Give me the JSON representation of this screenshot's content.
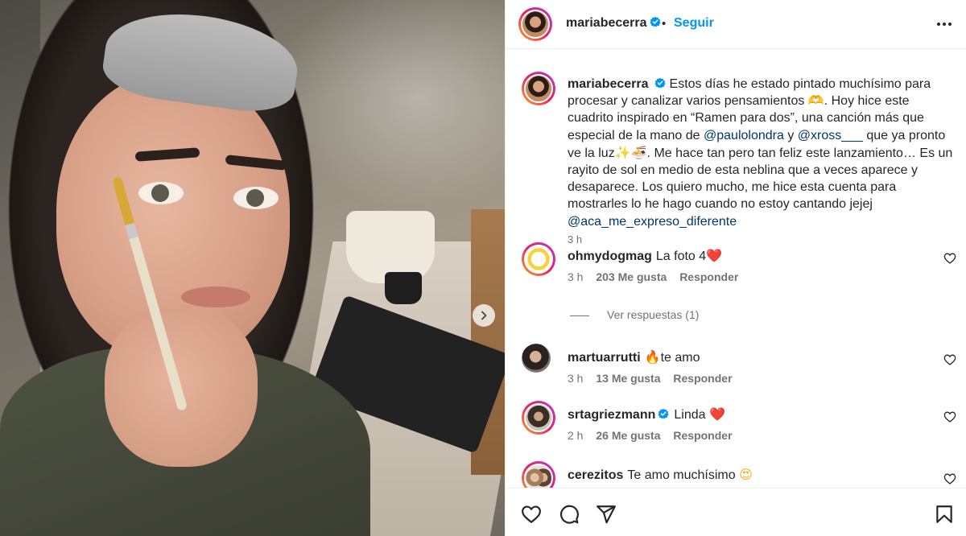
{
  "post": {
    "username": "mariabecerra",
    "follow_label": "Seguir",
    "separator": "•"
  },
  "caption": {
    "username": "mariabecerra",
    "text_1": "Estos días he estado pintado muchísimo para procesar y canalizar varios pensamientos 🫶. Hoy hice este cuadrito inspirado en “Ramen para dos”, una canción más que especial de la mano de ",
    "mention_1": "@paulolondra",
    "text_2": " y ",
    "mention_2": "@xross___",
    "text_3": " que ya pronto ve la luz",
    "emoji_1": "✨🍜",
    "text_4": ". Me hace tan pero tan feliz este lanzamiento… Es un rayito de sol en medio de esta neblina que a veces aparece y desaparece. Los quiero mucho, me hice esta cuenta para mostrarles lo he hago cuando no estoy cantando jejej ",
    "mention_3": "@aca_me_expreso_diferente",
    "time": "3 h"
  },
  "comments": [
    {
      "username": "ohmydogmag",
      "text": "La foto 4",
      "emoji": "❤️",
      "time": "3 h",
      "likes": "203 Me gusta",
      "reply": "Responder",
      "avatar": "face-b",
      "verified": false,
      "ring": true
    },
    {
      "username": "martuarrutti",
      "text": "te amo",
      "emoji_pre": "🔥",
      "time": "3 h",
      "likes": "13 Me gusta",
      "reply": "Responder",
      "avatar": "face-c",
      "verified": false,
      "ring": false
    },
    {
      "username": "srtagriezmann",
      "text": "Linda",
      "emoji": "❤️",
      "time": "2 h",
      "likes": "26 Me gusta",
      "reply": "Responder",
      "avatar": "face-d",
      "verified": true,
      "ring": true
    },
    {
      "username": "cerezitos",
      "text": "Te amo muchísimo",
      "emoji": "😍",
      "time": "",
      "likes": "",
      "reply": "",
      "avatar": "face-e",
      "verified": false,
      "ring": true
    }
  ],
  "view_replies": "Ver respuestas (1)",
  "icons": {
    "verified": "verified-badge-icon",
    "more": "more-options-icon",
    "like": "heart-icon",
    "comment": "comment-icon",
    "share": "share-icon",
    "save": "bookmark-icon",
    "next": "chevron-right-icon"
  },
  "colors": {
    "accent": "#0095f6",
    "mention": "#00376b",
    "muted": "#737373",
    "verified": "#0095f6",
    "heart": "#ed4956"
  }
}
